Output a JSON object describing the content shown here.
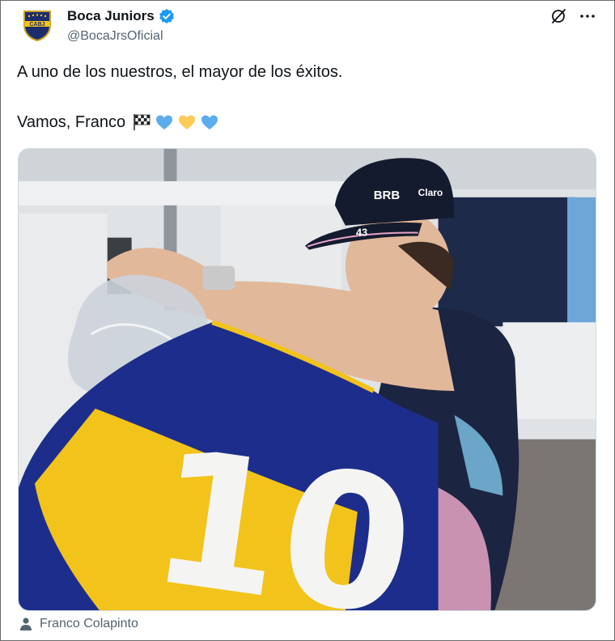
{
  "account": {
    "display_name": "Boca Juniors",
    "handle": "@BocaJrsOficial",
    "verified": true,
    "avatar_icon": "boca-juniors-crest-icon",
    "crest_text": "CABJ"
  },
  "header_actions": [
    {
      "icon": "grok-icon"
    },
    {
      "icon": "more-options-icon"
    }
  ],
  "tweet": {
    "text_line_1": "A uno de los nuestros, el mayor de los éxitos.",
    "text_line_2": "Vamos, Franco",
    "emojis": [
      "chequered-flag-emoji",
      "blue-heart-emoji",
      "yellow-heart-emoji",
      "blue-heart-emoji"
    ]
  },
  "media": {
    "jersey_number": "10",
    "cap_sponsor": "BRB",
    "cap_sponsor_2": "Claro",
    "cap_number": "43"
  },
  "tagged_user": {
    "icon": "person-icon",
    "label": "Franco Colapinto"
  },
  "colors": {
    "text": "#0f1419",
    "secondary_text": "#536471",
    "verified_blue": "#1d9bf0",
    "boca_blue": "#1d2d8c",
    "boca_yellow": "#f2c31b"
  }
}
